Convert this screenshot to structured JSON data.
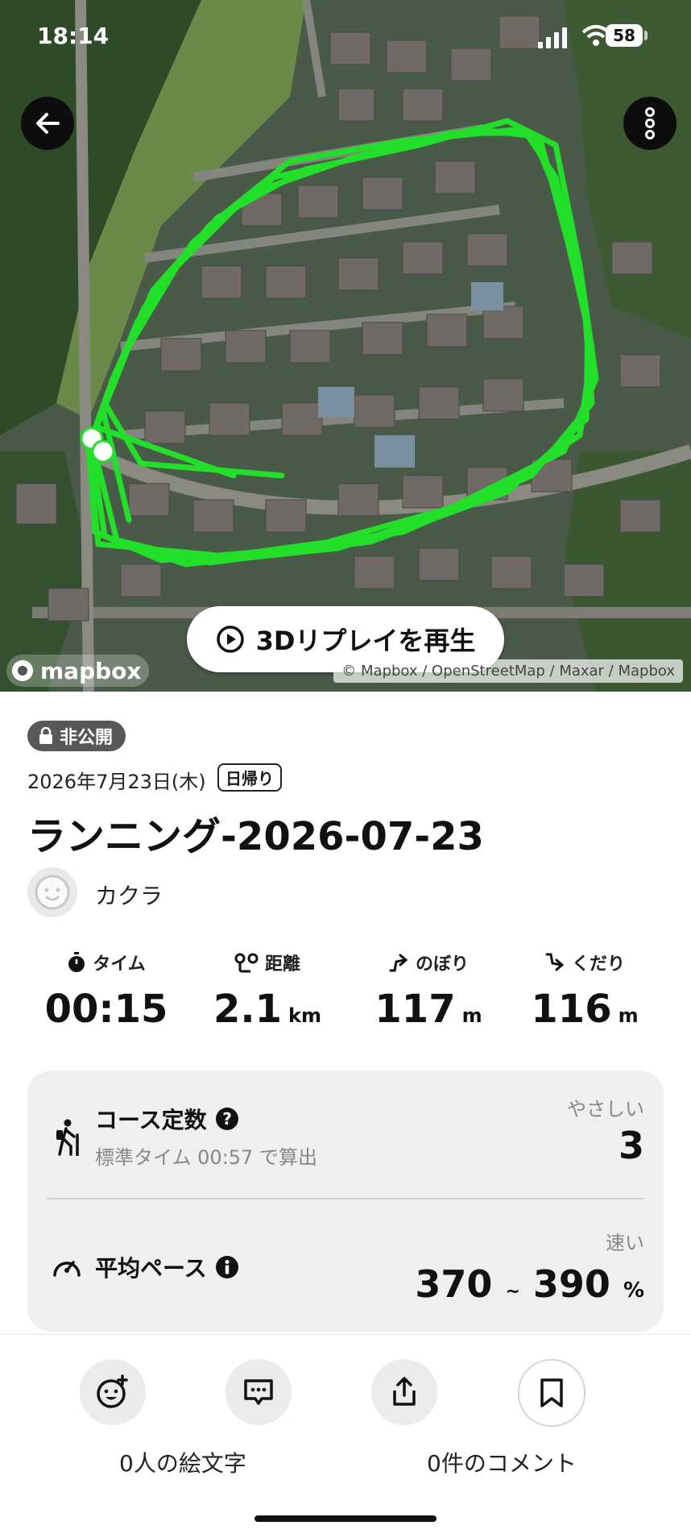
{
  "status_bar": {
    "time": "18:14",
    "battery": "58"
  },
  "map": {
    "replay_label": "3Dリプレイを再生",
    "logo": "mapbox",
    "attribution": "© Mapbox / OpenStreetMap / Maxar / Mapbox",
    "track_color": "#22e02a"
  },
  "activity": {
    "visibility": "非公開",
    "date": "2026年7月23日(木)",
    "trip_type": "日帰り",
    "title": "ランニング-2026-07-23",
    "user": "カクラ"
  },
  "stats": [
    {
      "label": "タイム",
      "value": "00:15",
      "unit": ""
    },
    {
      "label": "距離",
      "value": "2.1",
      "unit": "km"
    },
    {
      "label": "のぼり",
      "value": "117",
      "unit": "m"
    },
    {
      "label": "くだり",
      "value": "116",
      "unit": "m"
    }
  ],
  "course": {
    "title": "コース定数",
    "sub": "標準タイム 00:57 で算出",
    "grade": "やさしい",
    "value": "3"
  },
  "pace": {
    "title": "平均ペース",
    "grade": "速い",
    "value_low": "370",
    "sep": "~",
    "value_high": "390",
    "unit": "%"
  },
  "actions": {
    "emoji_label": "0人の絵文字",
    "comment_label": "0件のコメント"
  },
  "colors": {
    "accent": "#22e02a",
    "badge": "#585858",
    "card": "#efefef"
  }
}
